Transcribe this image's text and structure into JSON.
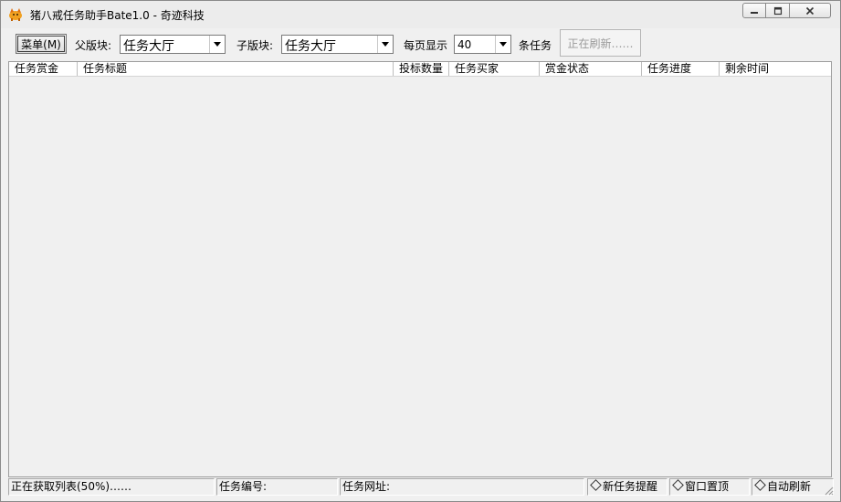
{
  "window": {
    "title": "猪八戒任务助手Bate1.0 - 奇迹科技",
    "icon": "pig-app-icon"
  },
  "toolbar": {
    "menu_label": "菜单(M)",
    "parent_label": "父版块:",
    "parent_value": "任务大厅",
    "child_label": "子版块:",
    "child_value": "任务大厅",
    "per_page_label": "每页显示",
    "per_page_value": "40",
    "tasks_suffix": "条任务",
    "refresh_label": "正在刷新……"
  },
  "table": {
    "columns": [
      "任务赏金",
      "任务标题",
      "投标数量",
      "任务买家",
      "赏金状态",
      "任务进度",
      "剩余时间"
    ],
    "rows": []
  },
  "status": {
    "progress_text": "正在获取列表(50%)……",
    "task_id_label": "任务编号:",
    "task_url_label": "任务网址:",
    "new_task_alert": "新任务提醒",
    "window_top": "窗口置顶",
    "auto_refresh": "自动刷新"
  }
}
